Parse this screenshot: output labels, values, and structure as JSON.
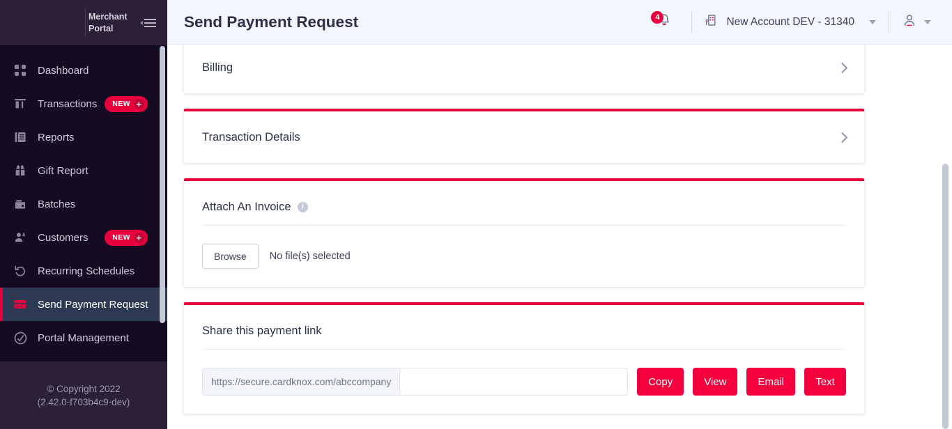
{
  "sidebar": {
    "brand": "Merchant Portal",
    "collapse_icon": "collapse-menu-icon",
    "items": [
      {
        "label": "Dashboard",
        "icon": "dashboard-grid-icon",
        "badge": null
      },
      {
        "label": "Transactions",
        "icon": "transactions-icon",
        "badge": "NEW"
      },
      {
        "label": "Reports",
        "icon": "reports-icon",
        "badge": null
      },
      {
        "label": "Gift Report",
        "icon": "gift-icon",
        "badge": null
      },
      {
        "label": "Batches",
        "icon": "batches-icon",
        "badge": null
      },
      {
        "label": "Customers",
        "icon": "customers-icon",
        "badge": "NEW"
      },
      {
        "label": "Recurring Schedules",
        "icon": "recurring-icon",
        "badge": null
      },
      {
        "label": "Send Payment Request",
        "icon": "credit-card-icon",
        "badge": null
      },
      {
        "label": "Portal Management",
        "icon": "portal-management-icon",
        "badge": null
      }
    ],
    "active_item": "Send Payment Request",
    "footer": {
      "copyright": "© Copyright 2022",
      "version": "(2.42.0-f703b4c9-dev)"
    }
  },
  "header": {
    "title": "Send Payment Request",
    "notifications": {
      "icon": "bell-icon",
      "count": "4"
    },
    "account": {
      "icon": "building-icon",
      "name": "New Account DEV - 31340",
      "caret": "chevron-down-icon"
    },
    "user": {
      "icon": "user-avatar-icon",
      "caret": "chevron-down-icon"
    }
  },
  "main": {
    "cards": [
      {
        "title": "Billing",
        "chevron": "chevron-right-icon"
      },
      {
        "title": "Transaction Details",
        "chevron": "chevron-right-icon"
      }
    ],
    "attach_invoice": {
      "title": "Attach An Invoice",
      "info_icon": "info-icon",
      "browse_label": "Browse",
      "file_status": "No file(s) selected"
    },
    "share_link": {
      "title": "Share this payment link",
      "url_prefix": "https://secure.cardknox.com/abccompany",
      "input_value": "",
      "input_placeholder": "",
      "buttons": [
        {
          "label": "Copy"
        },
        {
          "label": "View"
        },
        {
          "label": "Email"
        },
        {
          "label": "Text"
        }
      ]
    }
  },
  "colors": {
    "accent_red": "#e8003c",
    "button_red": "#f4003f",
    "sidebar_bg": "#150b23",
    "sidebar_head_bg": "#2b2038",
    "active_item_bg": "#2e3954",
    "topbar_bg": "#f3f6fd"
  }
}
